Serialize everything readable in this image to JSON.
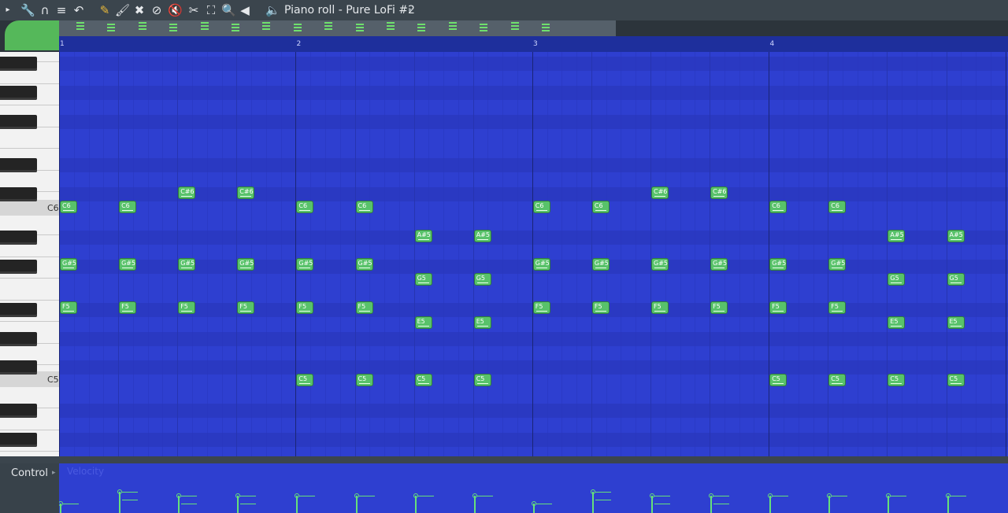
{
  "toolbar": {
    "title": "Piano roll - Pure LoFi #2",
    "icons": [
      {
        "name": "menu-arrow-icon",
        "glyph": "▸"
      },
      {
        "name": "wrench-icon",
        "glyph": "🔧"
      },
      {
        "name": "magnet-icon",
        "glyph": "∩"
      },
      {
        "name": "snap-icon",
        "glyph": "≡"
      },
      {
        "name": "undo-icon",
        "glyph": "↶"
      },
      {
        "name": "pencil-icon",
        "glyph": "✎"
      },
      {
        "name": "paint-brush-icon",
        "glyph": "🖌"
      },
      {
        "name": "delete-tool-icon",
        "glyph": "✖"
      },
      {
        "name": "mute-tool-icon",
        "glyph": "⊘"
      },
      {
        "name": "mute-speaker-icon",
        "glyph": "🔇"
      },
      {
        "name": "slice-tool-icon",
        "glyph": "✂"
      },
      {
        "name": "select-tool-icon",
        "glyph": "⛶"
      },
      {
        "name": "zoom-tool-icon",
        "glyph": "🔍"
      },
      {
        "name": "playback-tool-icon",
        "glyph": "◀"
      },
      {
        "name": "speaker-icon",
        "glyph": "🔈"
      }
    ],
    "colors": {
      "accent_tool": "#e8b83a",
      "icons": "#e6e9ec"
    }
  },
  "timeline": {
    "bars": [
      "1",
      "2",
      "3",
      "4"
    ]
  },
  "keyboard": {
    "labels": {
      "c6": "C6",
      "c5": "C5"
    }
  },
  "notes": [
    {
      "label": "C6",
      "bar": 0,
      "row": "C6"
    },
    {
      "label": "C6",
      "bar": 1,
      "row": "C6"
    },
    {
      "label": "C#6",
      "bar": 2,
      "row": "C#6"
    },
    {
      "label": "C#6",
      "bar": 3,
      "row": "C#6"
    },
    {
      "label": "C6",
      "bar": 4,
      "row": "C6"
    },
    {
      "label": "C6",
      "bar": 5,
      "row": "C6"
    },
    {
      "label": "A#5",
      "bar": 6,
      "row": "A#5"
    },
    {
      "label": "A#5",
      "bar": 7,
      "row": "A#5"
    },
    {
      "label": "C6",
      "bar": 8,
      "row": "C6"
    },
    {
      "label": "C6",
      "bar": 9,
      "row": "C6"
    },
    {
      "label": "C#6",
      "bar": 10,
      "row": "C#6"
    },
    {
      "label": "C#6",
      "bar": 11,
      "row": "C#6"
    },
    {
      "label": "C6",
      "bar": 12,
      "row": "C6"
    },
    {
      "label": "C6",
      "bar": 13,
      "row": "C6"
    },
    {
      "label": "A#5",
      "bar": 14,
      "row": "A#5"
    },
    {
      "label": "A#5",
      "bar": 15,
      "row": "A#5"
    },
    {
      "label": "G#5",
      "bar": 0,
      "row": "G#5"
    },
    {
      "label": "G#5",
      "bar": 1,
      "row": "G#5"
    },
    {
      "label": "G#5",
      "bar": 2,
      "row": "G#5"
    },
    {
      "label": "G#5",
      "bar": 3,
      "row": "G#5"
    },
    {
      "label": "G#5",
      "bar": 4,
      "row": "G#5"
    },
    {
      "label": "G#5",
      "bar": 5,
      "row": "G#5"
    },
    {
      "label": "G5",
      "bar": 6,
      "row": "G5"
    },
    {
      "label": "G5",
      "bar": 7,
      "row": "G5"
    },
    {
      "label": "G#5",
      "bar": 8,
      "row": "G#5"
    },
    {
      "label": "G#5",
      "bar": 9,
      "row": "G#5"
    },
    {
      "label": "G#5",
      "bar": 10,
      "row": "G#5"
    },
    {
      "label": "G#5",
      "bar": 11,
      "row": "G#5"
    },
    {
      "label": "G#5",
      "bar": 12,
      "row": "G#5"
    },
    {
      "label": "G#5",
      "bar": 13,
      "row": "G#5"
    },
    {
      "label": "G5",
      "bar": 14,
      "row": "G5"
    },
    {
      "label": "G5",
      "bar": 15,
      "row": "G5"
    },
    {
      "label": "F5",
      "bar": 0,
      "row": "F5"
    },
    {
      "label": "F5",
      "bar": 1,
      "row": "F5"
    },
    {
      "label": "F5",
      "bar": 2,
      "row": "F5"
    },
    {
      "label": "F5",
      "bar": 3,
      "row": "F5"
    },
    {
      "label": "F5",
      "bar": 4,
      "row": "F5"
    },
    {
      "label": "F5",
      "bar": 5,
      "row": "F5"
    },
    {
      "label": "E5",
      "bar": 6,
      "row": "E5"
    },
    {
      "label": "E5",
      "bar": 7,
      "row": "E5"
    },
    {
      "label": "F5",
      "bar": 8,
      "row": "F5"
    },
    {
      "label": "F5",
      "bar": 9,
      "row": "F5"
    },
    {
      "label": "F5",
      "bar": 10,
      "row": "F5"
    },
    {
      "label": "F5",
      "bar": 11,
      "row": "F5"
    },
    {
      "label": "F5",
      "bar": 12,
      "row": "F5"
    },
    {
      "label": "F5",
      "bar": 13,
      "row": "F5"
    },
    {
      "label": "E5",
      "bar": 14,
      "row": "E5"
    },
    {
      "label": "E5",
      "bar": 15,
      "row": "E5"
    },
    {
      "label": "C5",
      "bar": 4,
      "row": "C5"
    },
    {
      "label": "C5",
      "bar": 5,
      "row": "C5"
    },
    {
      "label": "C5",
      "bar": 6,
      "row": "C5"
    },
    {
      "label": "C5",
      "bar": 7,
      "row": "C5"
    },
    {
      "label": "C5",
      "bar": 12,
      "row": "C5"
    },
    {
      "label": "C5",
      "bar": 13,
      "row": "C5"
    },
    {
      "label": "C5",
      "bar": 14,
      "row": "C5"
    },
    {
      "label": "C5",
      "bar": 15,
      "row": "C5"
    }
  ],
  "control": {
    "label": "Control",
    "lane_label": "Velocity"
  },
  "colors": {
    "grid": "#2e3fd0",
    "note": "#58c26a",
    "velocity": "#66e07a"
  }
}
